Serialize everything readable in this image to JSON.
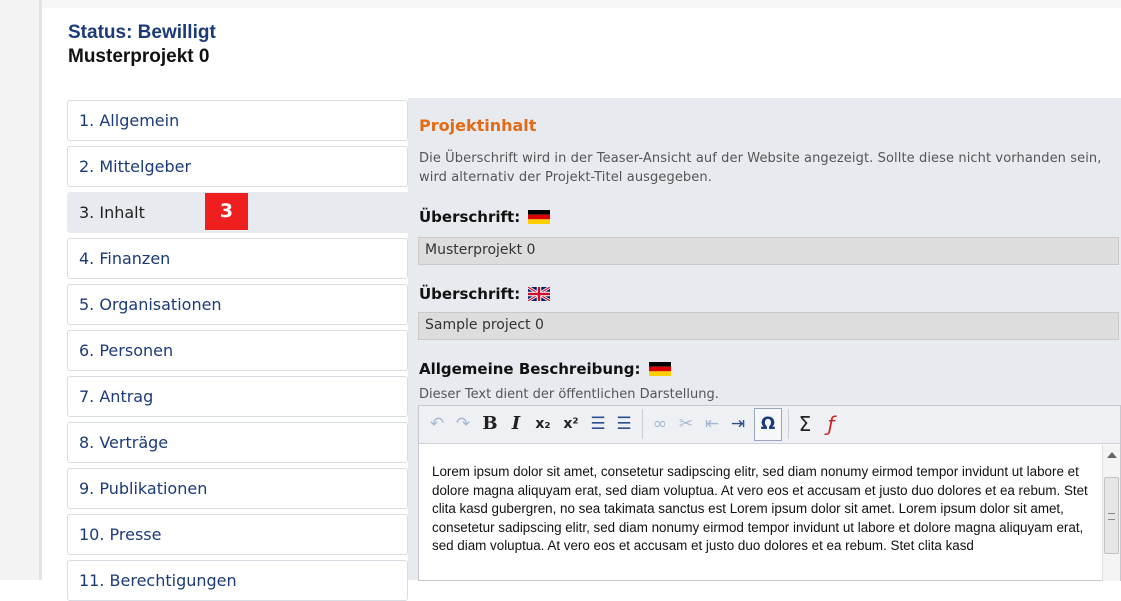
{
  "header": {
    "status": "Status: Bewilligt",
    "project_title": "Musterprojekt 0"
  },
  "nav": {
    "items": [
      {
        "label": "1. Allgemein"
      },
      {
        "label": "2. Mittelgeber"
      },
      {
        "label": "3. Inhalt",
        "active": true
      },
      {
        "label": "4. Finanzen"
      },
      {
        "label": "5. Organisationen"
      },
      {
        "label": "6. Personen"
      },
      {
        "label": "7. Antrag"
      },
      {
        "label": "8. Verträge"
      },
      {
        "label": "9. Publikationen"
      },
      {
        "label": "10. Presse"
      },
      {
        "label": "11. Berechtigungen"
      }
    ],
    "badge": "3"
  },
  "content": {
    "section_title": "Projektinhalt",
    "info_text": "Die Überschrift wird in der Teaser-Ansicht auf der Website angezeigt. Sollte diese nicht vorhanden sein, wird alternativ der Projekt-Titel ausgegeben.",
    "heading_de_label": "Überschrift:",
    "heading_de_value": "Musterprojekt 0",
    "heading_en_label": "Überschrift:",
    "heading_en_value": "Sample project 0",
    "description_label": "Allgemeine Beschreibung:",
    "description_hint": "Dieser Text dient der öffentlichen Darstellung.",
    "description_text": "Lorem ipsum dolor sit amet, consetetur sadipscing elitr, sed diam nonumy eirmod tempor invidunt ut labore et dolore magna aliquyam erat, sed diam voluptua. At vero eos et accusam et justo duo dolores et ea rebum. Stet clita kasd gubergren, no sea takimata sanctus est Lorem ipsum dolor sit amet. Lorem ipsum dolor sit amet, consetetur sadipscing elitr, sed diam nonumy eirmod tempor invidunt ut labore et dolore magna aliquyam erat, sed diam voluptua. At vero eos et accusam et justo duo dolores et ea rebum. Stet clita kasd"
  },
  "toolbar": {
    "undo": "↶",
    "redo": "↷",
    "bold": "B",
    "italic": "I",
    "subscript": "x₂",
    "superscript": "x²",
    "ordered_list": "☰",
    "unordered_list": "☰",
    "link": "∞",
    "unlink": "✂",
    "outdent": "⇤",
    "indent": "⇥",
    "special_char": "Ω",
    "sum": "Σ",
    "formula": "ƒ"
  },
  "colors": {
    "status_blue": "#1b3a78",
    "section_orange": "#e46b16",
    "badge_red": "#ef1f1f",
    "panel_bg": "#e7eaef"
  },
  "icons": {
    "flag_de": "german-flag-icon",
    "flag_en": "uk-flag-icon"
  }
}
